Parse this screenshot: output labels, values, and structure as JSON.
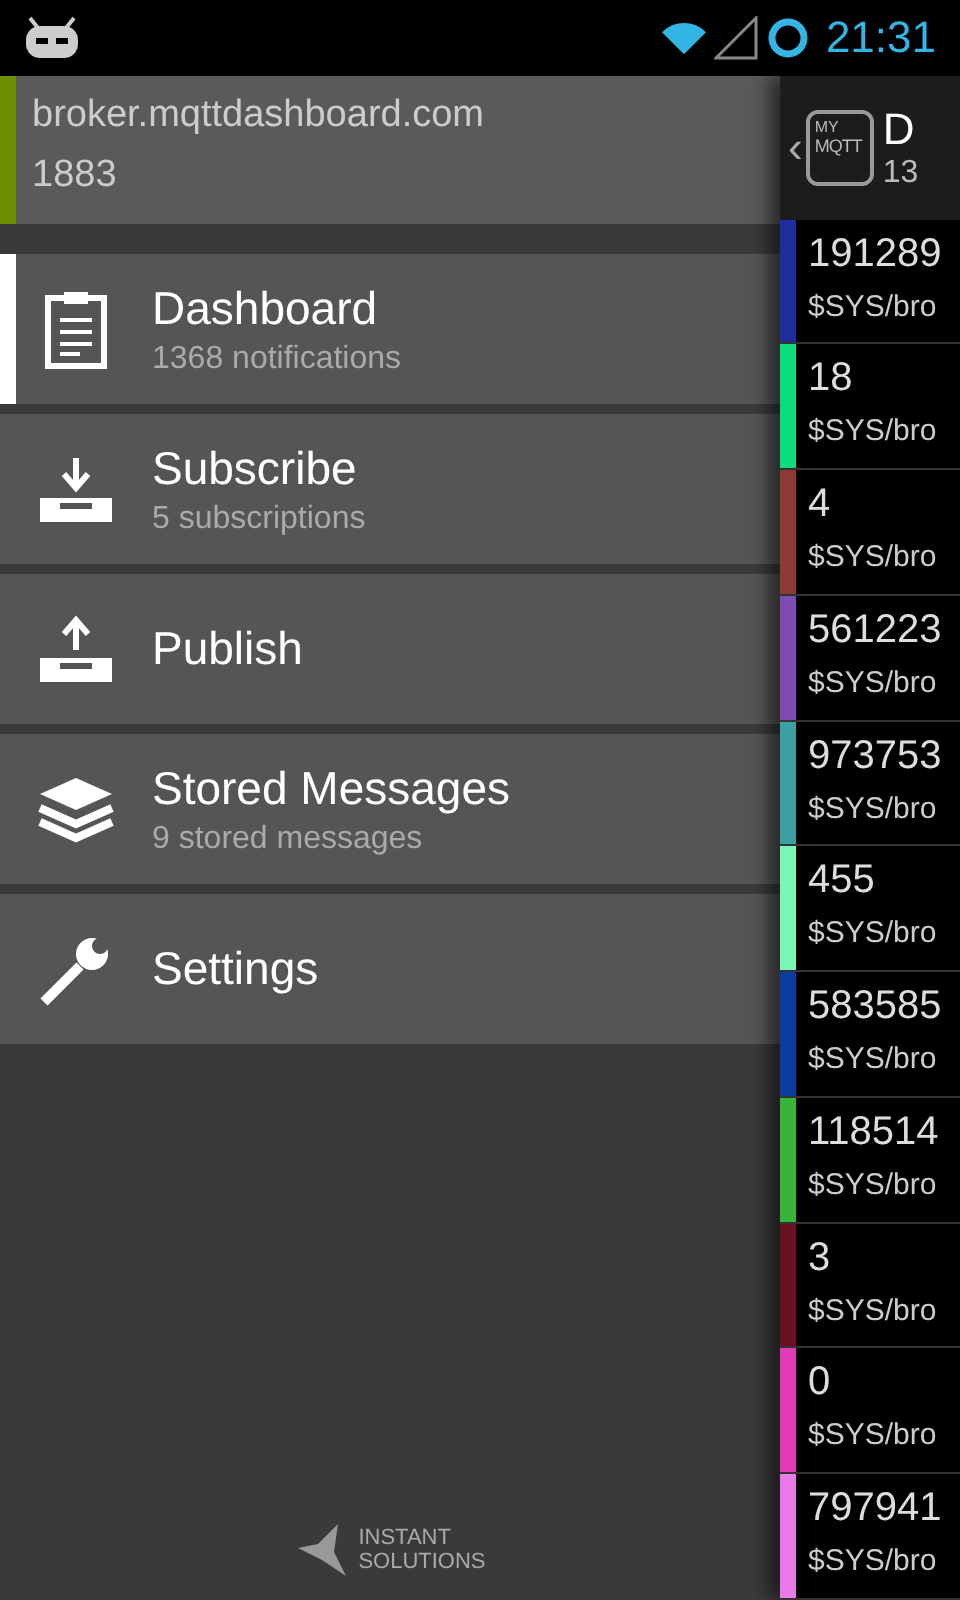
{
  "status_bar": {
    "time": "21:31"
  },
  "broker": {
    "host": "broker.mqttdashboard.com",
    "port": "1883"
  },
  "menu": [
    {
      "kind": "dashboard",
      "label": "Dashboard",
      "subtitle": "1368 notifications",
      "selected": true
    },
    {
      "kind": "subscribe",
      "label": "Subscribe",
      "subtitle": "5 subscriptions",
      "selected": false
    },
    {
      "kind": "publish",
      "label": "Publish",
      "selected": false
    },
    {
      "kind": "stored",
      "label": "Stored Messages",
      "subtitle": "9 stored messages",
      "selected": false
    },
    {
      "kind": "settings",
      "label": "Settings",
      "selected": false
    }
  ],
  "footer_logo": {
    "line_1": "INSTANT",
    "line_2": "SOLUTIONS"
  },
  "action_bar": {
    "back": "‹",
    "logo_line_1": "MY",
    "logo_line_2": "MQTT",
    "title": "D",
    "subtitle": "13"
  },
  "messages": [
    {
      "value": "191289",
      "topic": "$SYS/bro",
      "color": "#1f2e9c"
    },
    {
      "value": "18",
      "topic": "$SYS/bro",
      "color": "#0fdc7c"
    },
    {
      "value": "4",
      "topic": "$SYS/bro",
      "color": "#8c3a33"
    },
    {
      "value": "561223",
      "topic": "$SYS/bro",
      "color": "#7a4cb4"
    },
    {
      "value": "973753",
      "topic": "$SYS/bro",
      "color": "#3aa0a0"
    },
    {
      "value": "455",
      "topic": "$SYS/bro",
      "color": "#7cf6b4"
    },
    {
      "value": "583585",
      "topic": "$SYS/bro",
      "color": "#0c3c9c"
    },
    {
      "value": "118514",
      "topic": "$SYS/bro",
      "color": "#36b43c"
    },
    {
      "value": "3",
      "topic": "$SYS/bro",
      "color": "#6c1026"
    },
    {
      "value": "0",
      "topic": "$SYS/bro",
      "color": "#e03cb8"
    },
    {
      "value": "797941",
      "topic": "$SYS/bro",
      "color": "#ea7aea"
    }
  ]
}
